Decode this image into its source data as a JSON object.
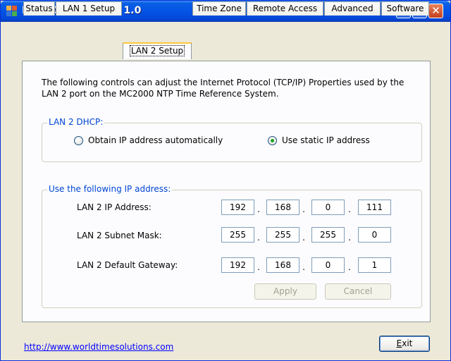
{
  "window": {
    "title": "MC2000 Interface 1.0"
  },
  "tabs": [
    {
      "label": "Status"
    },
    {
      "label": "LAN 1 Setup"
    },
    {
      "label": "LAN 2 Setup"
    },
    {
      "label": "Time Zone"
    },
    {
      "label": "Remote Access"
    },
    {
      "label": "Advanced"
    },
    {
      "label": "Software"
    }
  ],
  "active_tab": "LAN 2 Setup",
  "panel": {
    "description": "The following controls can adjust the Internet Protocol (TCP/IP) Properties used by the LAN 2 port on the MC2000 NTP Time Reference System.",
    "dhcp_group": {
      "label": "LAN 2 DHCP:",
      "option_auto": "Obtain IP address automatically",
      "option_static": "Use static IP address",
      "selected": "static"
    },
    "ip_group": {
      "label": "Use the following IP address:",
      "rows": [
        {
          "label": "LAN 2 IP Address:",
          "octets": [
            "192",
            "168",
            "0",
            "111"
          ]
        },
        {
          "label": "LAN 2 Subnet Mask:",
          "octets": [
            "255",
            "255",
            "255",
            "0"
          ]
        },
        {
          "label": "LAN 2 Default Gateway:",
          "octets": [
            "192",
            "168",
            "0",
            "1"
          ]
        }
      ],
      "apply_label": "Apply",
      "cancel_label": "Cancel",
      "separator": "."
    }
  },
  "footer": {
    "link": "http://www.worldtimesolutions.com",
    "exit_label": "Exit"
  },
  "colors": {
    "titlebar": "#0454e6",
    "group_label": "#0046d5",
    "active_tab_accent": "#ffc83c",
    "link": "#0000ff"
  }
}
